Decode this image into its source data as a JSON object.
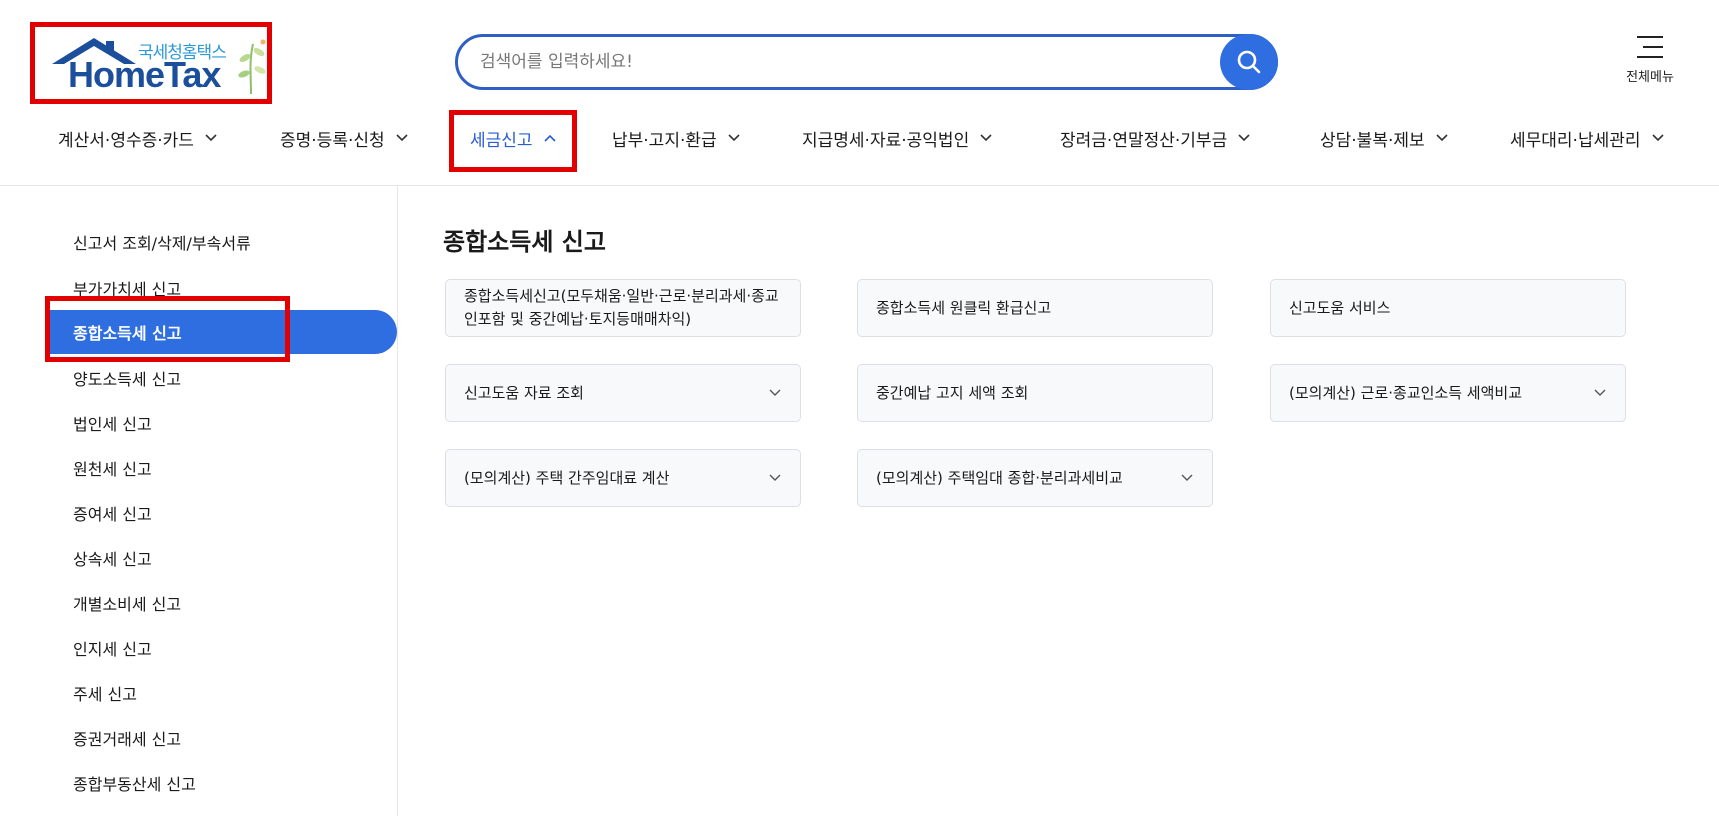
{
  "logo": {
    "sub_text": "국세청홈택스",
    "main_text": "HomeTax"
  },
  "search": {
    "placeholder": "검색어를 입력하세요!",
    "button_icon": "search-icon"
  },
  "all_menu": {
    "label": "전체메뉴",
    "icon": "hamburger-icon"
  },
  "top_nav": {
    "items": [
      {
        "label": "계산서·영수증·카드",
        "active": false
      },
      {
        "label": "증명·등록·신청",
        "active": false
      },
      {
        "label": "세금신고",
        "active": true
      },
      {
        "label": "납부·고지·환급",
        "active": false
      },
      {
        "label": "지급명세·자료·공익법인",
        "active": false
      },
      {
        "label": "장려금·연말정산·기부금",
        "active": false
      },
      {
        "label": "상담·불복·제보",
        "active": false
      },
      {
        "label": "세무대리·납세관리",
        "active": false
      }
    ]
  },
  "sidebar": {
    "items": [
      {
        "label": "신고서 조회/삭제/부속서류",
        "active": false
      },
      {
        "label": "부가가치세 신고",
        "active": false
      },
      {
        "label": "종합소득세 신고",
        "active": true
      },
      {
        "label": "양도소득세 신고",
        "active": false
      },
      {
        "label": "법인세 신고",
        "active": false
      },
      {
        "label": "원천세 신고",
        "active": false
      },
      {
        "label": "증여세 신고",
        "active": false
      },
      {
        "label": "상속세 신고",
        "active": false
      },
      {
        "label": "개별소비세 신고",
        "active": false
      },
      {
        "label": "인지세 신고",
        "active": false
      },
      {
        "label": "주세 신고",
        "active": false
      },
      {
        "label": "증권거래세 신고",
        "active": false
      },
      {
        "label": "종합부동산세 신고",
        "active": false
      }
    ]
  },
  "main": {
    "title": "종합소득세 신고",
    "cards": [
      {
        "label": "종합소득세신고(모두채움·일반·근로·분리과세·종교인포함 및 중간예납·토지등매매차익)",
        "has_dropdown": false
      },
      {
        "label": "종합소득세 원클릭 환급신고",
        "has_dropdown": false
      },
      {
        "label": "신고도움 서비스",
        "has_dropdown": false
      },
      {
        "label": "신고도움 자료 조회",
        "has_dropdown": true
      },
      {
        "label": "중간예납 고지 세액 조회",
        "has_dropdown": false
      },
      {
        "label": "(모의계산) 근로·종교인소득 세액비교",
        "has_dropdown": true
      },
      {
        "label": "(모의계산) 주택 간주임대료 계산",
        "has_dropdown": true
      },
      {
        "label": "(모의계산) 주택임대 종합·분리과세비교",
        "has_dropdown": true
      }
    ]
  },
  "colors": {
    "accent": "#2f6ee0",
    "highlight_box": "#e30000",
    "logo_blue": "#1b4f9c",
    "logo_light_blue": "#2e9ad6"
  }
}
